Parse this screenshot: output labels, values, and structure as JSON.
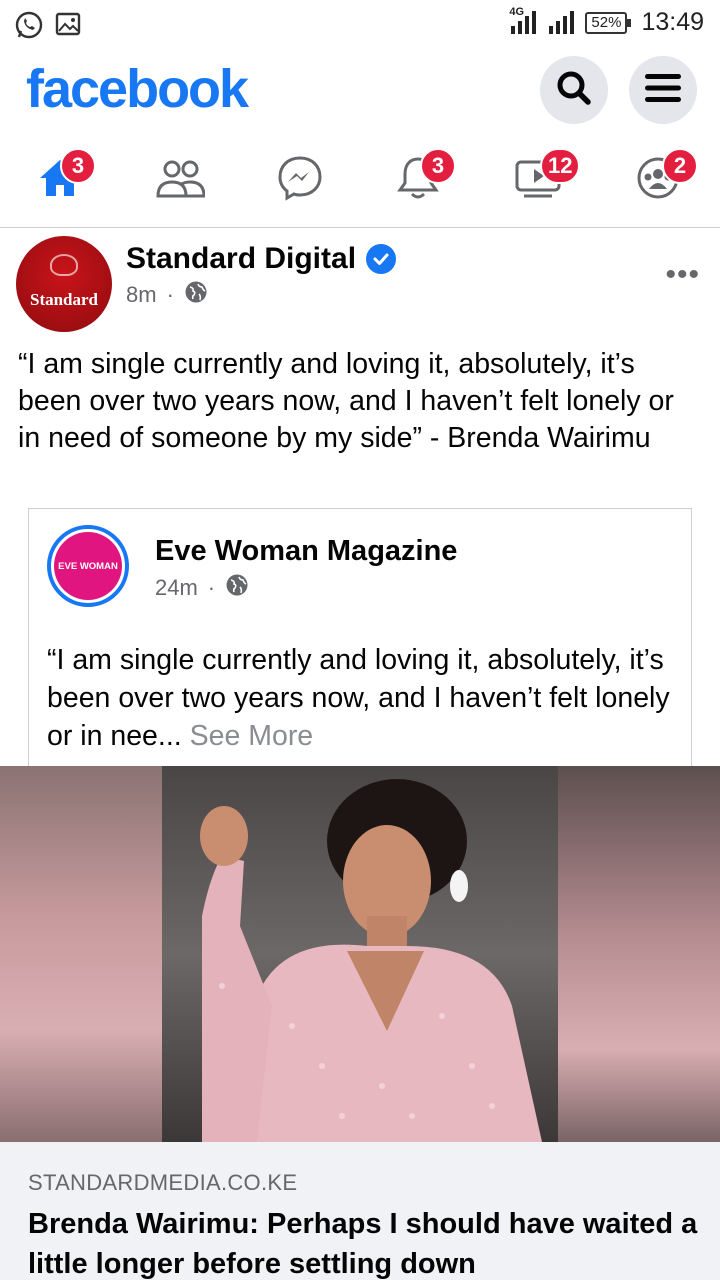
{
  "status_bar": {
    "network": "4G",
    "battery": "52%",
    "time": "13:49"
  },
  "header": {
    "logo": "facebook"
  },
  "nav": {
    "tabs": [
      {
        "name": "home",
        "badge": "3"
      },
      {
        "name": "friends",
        "badge": ""
      },
      {
        "name": "messenger",
        "badge": ""
      },
      {
        "name": "notifications",
        "badge": "3"
      },
      {
        "name": "watch",
        "badge": "12"
      },
      {
        "name": "groups",
        "badge": "2"
      }
    ]
  },
  "post": {
    "author": "Standard Digital",
    "avatar_text": "Standard",
    "time": "8m",
    "text": "“I am single currently and loving it, absolutely, it’s been over two years now, and I haven’t felt lonely or in need of someone by my side” - Brenda Wairimu",
    "shared": {
      "author": "Eve Woman Magazine",
      "avatar_text": "EVE WOMAN",
      "time": "24m",
      "text": "“I am single currently and loving it, absolutely, it’s been over two years now, and I haven’t felt lonely or in nee...",
      "see_more": "See More"
    },
    "link": {
      "domain": "STANDARDMEDIA.CO.KE",
      "headline": "Brenda Wairimu: Perhaps I should have waited a little longer before settling down"
    }
  },
  "colors": {
    "brand": "#1877f2",
    "badge": "#e41e3f",
    "muted": "#65676b"
  }
}
